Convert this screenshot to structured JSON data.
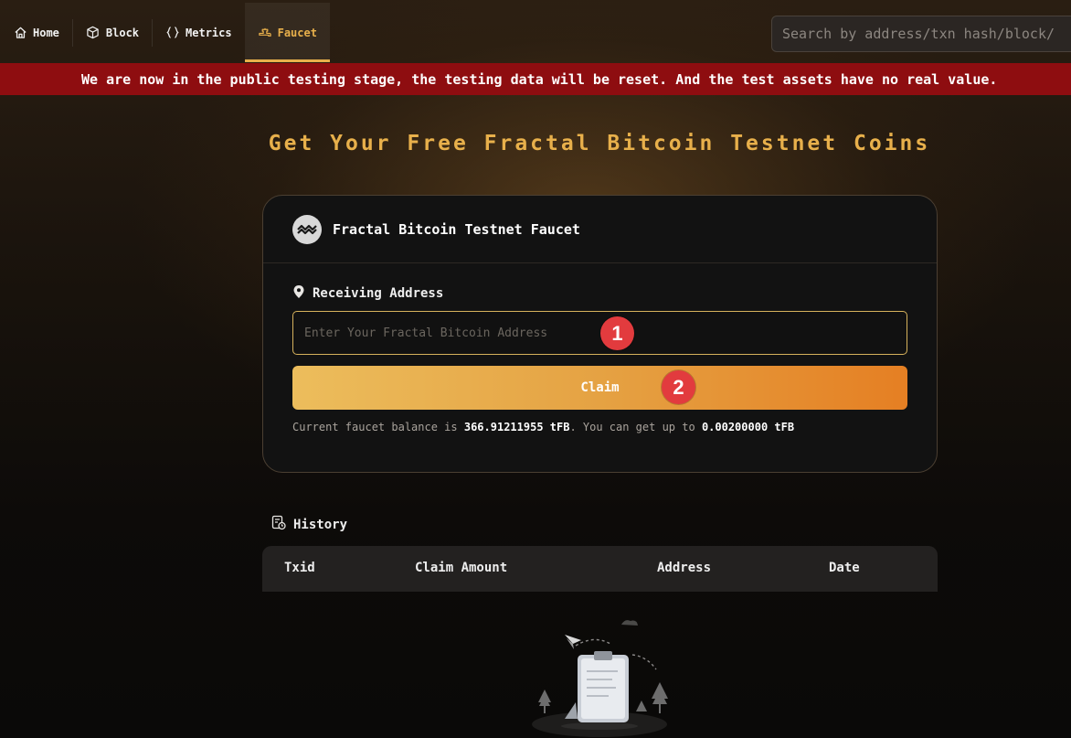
{
  "nav": {
    "items": [
      {
        "label": "Home",
        "icon": "home-icon"
      },
      {
        "label": "Block",
        "icon": "cube-icon"
      },
      {
        "label": "Metrics",
        "icon": "braces-icon"
      },
      {
        "label": "Faucet",
        "icon": "faucet-icon",
        "active": true
      }
    ],
    "search_placeholder": "Search by address/txn hash/block/"
  },
  "banner": {
    "text": "We are now in the public testing stage, the testing data will be reset. And the test assets have no real value."
  },
  "page_title": "Get Your Free Fractal Bitcoin Testnet Coins",
  "card": {
    "title": "Fractal Bitcoin Testnet Faucet",
    "field_label": "Receiving Address",
    "input_placeholder": "Enter Your Fractal Bitcoin Address",
    "input_value": "",
    "claim_label": "Claim",
    "balance_prefix": "Current faucet balance is ",
    "balance_value": "366.91211955 tFB",
    "balance_middle": ". You can get up to ",
    "limit_value": "0.00200000 tFB"
  },
  "markers": [
    "1",
    "2"
  ],
  "history": {
    "title": "History",
    "columns": [
      "Txid",
      "Claim Amount",
      "Address",
      "Date"
    ],
    "rows": []
  },
  "colors": {
    "accent": "#e8b04b",
    "banner": "#8e0d10",
    "marker": "#e23b3e"
  }
}
